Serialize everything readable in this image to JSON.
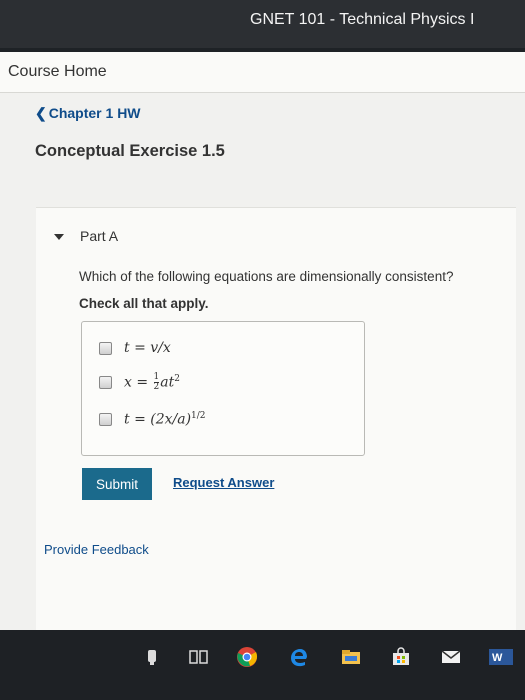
{
  "window": {
    "title": "GNET 101 - Technical Physics I"
  },
  "nav": {
    "course_home": "Course Home",
    "back_label": "Chapter 1 HW",
    "back_chevron": "❮"
  },
  "exercise": {
    "title": "Conceptual Exercise 1.5"
  },
  "part": {
    "label": "Part A",
    "question": "Which of the following equations are dimensionally consistent?",
    "instruction": "Check all that apply.",
    "options": [
      {
        "text": "t = v/x",
        "checked": false
      },
      {
        "text": "x = ½at²",
        "checked": false
      },
      {
        "text": "t = (2x/a)^(1/2)",
        "checked": false
      }
    ],
    "submit_label": "Submit",
    "request_label": "Request Answer"
  },
  "footer": {
    "feedback_label": "Provide Feedback"
  },
  "taskbar": {
    "icons": [
      "audio-icon",
      "task-view-icon",
      "chrome-icon",
      "edge-icon",
      "file-explorer-icon",
      "store-icon",
      "mail-icon",
      "word-icon"
    ]
  },
  "colors": {
    "accent_button": "#1b6a8c",
    "link": "#0f4c8a",
    "topbar": "#2c2f33"
  }
}
